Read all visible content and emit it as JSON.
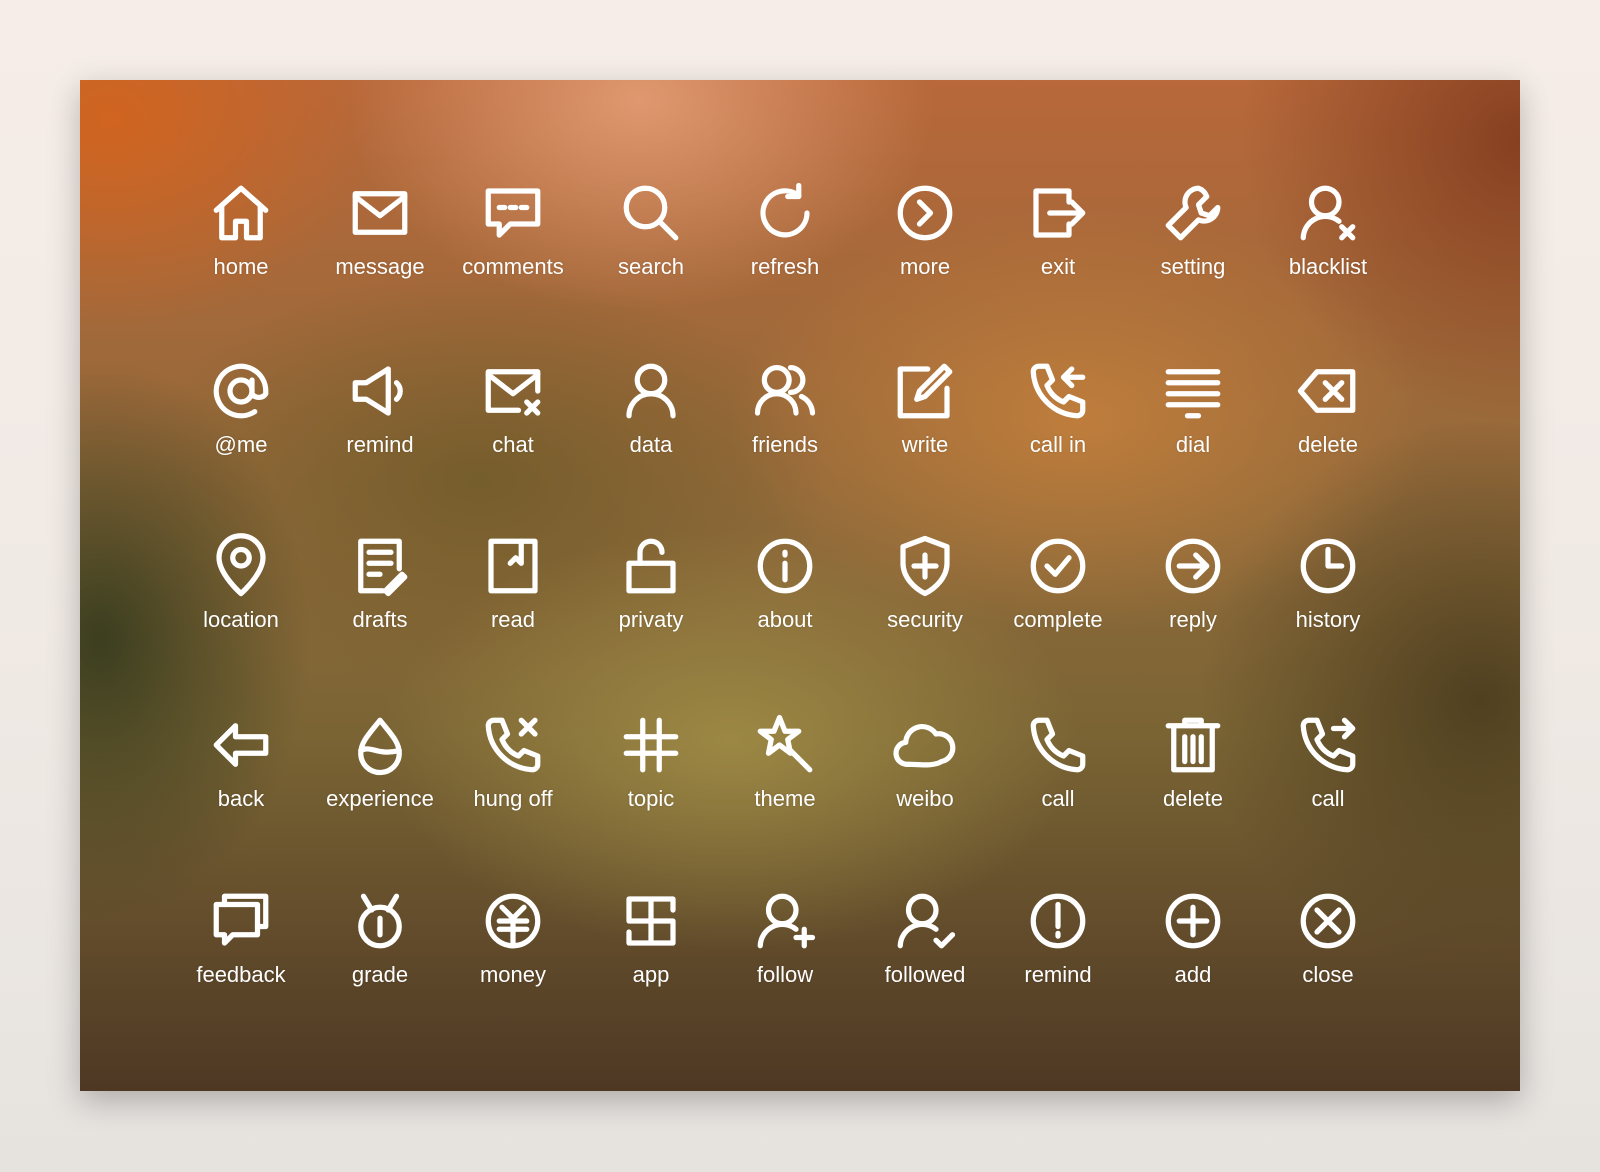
{
  "icon_color": "#ffffff",
  "rows": [
    [
      {
        "icon": "home-icon",
        "label": "home"
      },
      {
        "icon": "envelope-icon",
        "label": "message"
      },
      {
        "icon": "comment-bubble-icon",
        "label": "comments"
      },
      {
        "icon": "search-icon",
        "label": "search"
      },
      {
        "icon": "refresh-icon",
        "label": "refresh"
      },
      {
        "icon": "chevron-circle-right-icon",
        "label": "more"
      },
      {
        "icon": "exit-icon",
        "label": "exit"
      },
      {
        "icon": "wrench-icon",
        "label": "setting"
      },
      {
        "icon": "user-x-icon",
        "label": "blacklist"
      }
    ],
    [
      {
        "icon": "at-icon",
        "label": "@me"
      },
      {
        "icon": "speaker-icon",
        "label": "remind"
      },
      {
        "icon": "envelope-x-icon",
        "label": "chat"
      },
      {
        "icon": "user-icon",
        "label": "data"
      },
      {
        "icon": "users-icon",
        "label": "friends"
      },
      {
        "icon": "edit-icon",
        "label": "write"
      },
      {
        "icon": "phone-incoming-icon",
        "label": "call in"
      },
      {
        "icon": "list-icon",
        "label": "dial"
      },
      {
        "icon": "backspace-icon",
        "label": "delete"
      }
    ],
    [
      {
        "icon": "location-pin-icon",
        "label": "location"
      },
      {
        "icon": "draft-icon",
        "label": "drafts"
      },
      {
        "icon": "book-icon",
        "label": "read"
      },
      {
        "icon": "unlock-icon",
        "label": "privaty"
      },
      {
        "icon": "info-icon",
        "label": "about"
      },
      {
        "icon": "shield-plus-icon",
        "label": "security"
      },
      {
        "icon": "check-circle-icon",
        "label": "complete"
      },
      {
        "icon": "arrow-circle-right-icon",
        "label": "reply"
      },
      {
        "icon": "clock-icon",
        "label": "history"
      }
    ],
    [
      {
        "icon": "arrow-left-icon",
        "label": "back"
      },
      {
        "icon": "drop-icon",
        "label": "experience"
      },
      {
        "icon": "phone-x-icon",
        "label": "hung off"
      },
      {
        "icon": "hash-icon",
        "label": "topic"
      },
      {
        "icon": "magic-star-icon",
        "label": "theme"
      },
      {
        "icon": "cloud-icon",
        "label": "weibo"
      },
      {
        "icon": "phone-icon",
        "label": "call"
      },
      {
        "icon": "trash-icon",
        "label": "delete"
      },
      {
        "icon": "phone-outgoing-icon",
        "label": "call"
      }
    ],
    [
      {
        "icon": "chat-stack-icon",
        "label": "feedback"
      },
      {
        "icon": "grade-icon",
        "label": "grade"
      },
      {
        "icon": "money-icon",
        "label": "money"
      },
      {
        "icon": "app-icon",
        "label": "app"
      },
      {
        "icon": "user-plus-icon",
        "label": "follow"
      },
      {
        "icon": "user-check-icon",
        "label": "followed"
      },
      {
        "icon": "alert-circle-icon",
        "label": "remind"
      },
      {
        "icon": "plus-circle-icon",
        "label": "add"
      },
      {
        "icon": "x-circle-icon",
        "label": "close"
      }
    ]
  ]
}
